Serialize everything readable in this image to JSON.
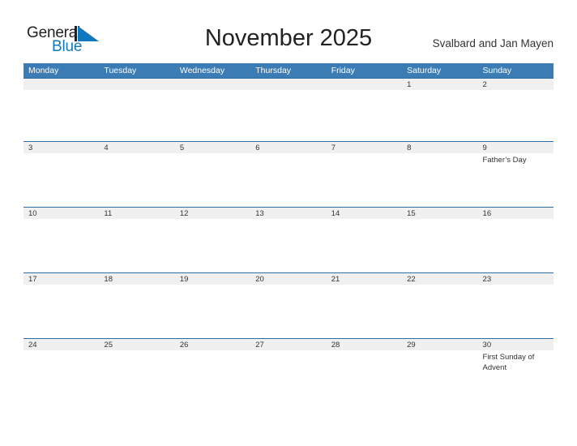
{
  "brand": {
    "name_part1": "General",
    "name_part2": "Blue",
    "triangle_icon": "blue-triangle-icon",
    "accent_color": "#1278be"
  },
  "header": {
    "title": "November 2025",
    "subtitle": "Svalbard and Jan Mayen"
  },
  "colors": {
    "weekday_header_bg": "#3b7cb4",
    "date_band_bg": "#f0f0f0",
    "row_border": "#2f6ea5",
    "page_bg": "#ffffff",
    "text": "#333333"
  },
  "calendar": {
    "month": "November",
    "year": "2025",
    "weekdays": [
      "Monday",
      "Tuesday",
      "Wednesday",
      "Thursday",
      "Friday",
      "Saturday",
      "Sunday"
    ],
    "weeks": [
      {
        "days": [
          {
            "date": "",
            "events": []
          },
          {
            "date": "",
            "events": []
          },
          {
            "date": "",
            "events": []
          },
          {
            "date": "",
            "events": []
          },
          {
            "date": "",
            "events": []
          },
          {
            "date": "1",
            "events": []
          },
          {
            "date": "2",
            "events": []
          }
        ]
      },
      {
        "days": [
          {
            "date": "3",
            "events": []
          },
          {
            "date": "4",
            "events": []
          },
          {
            "date": "5",
            "events": []
          },
          {
            "date": "6",
            "events": []
          },
          {
            "date": "7",
            "events": []
          },
          {
            "date": "8",
            "events": []
          },
          {
            "date": "9",
            "events": [
              "Father’s Day"
            ]
          }
        ]
      },
      {
        "days": [
          {
            "date": "10",
            "events": []
          },
          {
            "date": "11",
            "events": []
          },
          {
            "date": "12",
            "events": []
          },
          {
            "date": "13",
            "events": []
          },
          {
            "date": "14",
            "events": []
          },
          {
            "date": "15",
            "events": []
          },
          {
            "date": "16",
            "events": []
          }
        ]
      },
      {
        "days": [
          {
            "date": "17",
            "events": []
          },
          {
            "date": "18",
            "events": []
          },
          {
            "date": "19",
            "events": []
          },
          {
            "date": "20",
            "events": []
          },
          {
            "date": "21",
            "events": []
          },
          {
            "date": "22",
            "events": []
          },
          {
            "date": "23",
            "events": []
          }
        ]
      },
      {
        "days": [
          {
            "date": "24",
            "events": []
          },
          {
            "date": "25",
            "events": []
          },
          {
            "date": "26",
            "events": []
          },
          {
            "date": "27",
            "events": []
          },
          {
            "date": "28",
            "events": []
          },
          {
            "date": "29",
            "events": []
          },
          {
            "date": "30",
            "events": [
              "First Sunday of Advent"
            ]
          }
        ]
      }
    ]
  }
}
